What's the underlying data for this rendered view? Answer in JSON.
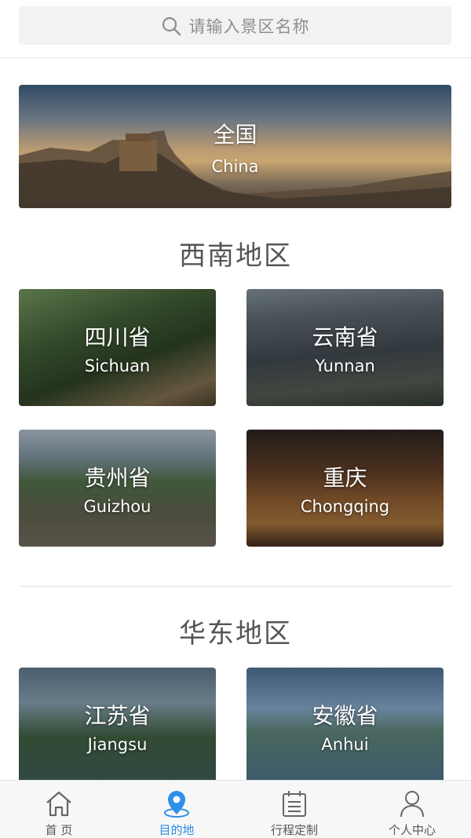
{
  "search": {
    "placeholder": "请输入景区名称"
  },
  "banner": {
    "title_cn": "全国",
    "title_en": "China"
  },
  "sections": [
    {
      "title": "西南地区",
      "cards": [
        {
          "cn": "四川省",
          "en": "Sichuan"
        },
        {
          "cn": "云南省",
          "en": "Yunnan"
        },
        {
          "cn": "贵州省",
          "en": "Guizhou"
        },
        {
          "cn": "重庆",
          "en": "Chongqing"
        }
      ]
    },
    {
      "title": "华东地区",
      "cards": [
        {
          "cn": "江苏省",
          "en": "Jiangsu"
        },
        {
          "cn": "安徽省",
          "en": "Anhui"
        }
      ]
    }
  ],
  "tabbar": {
    "active_color": "#2d8fe8",
    "items": [
      {
        "label": "首 页",
        "icon": "home-icon"
      },
      {
        "label": "目的地",
        "icon": "location-pin-icon",
        "active": true
      },
      {
        "label": "行程定制",
        "icon": "calendar-icon"
      },
      {
        "label": "个人中心",
        "icon": "user-icon"
      }
    ]
  }
}
